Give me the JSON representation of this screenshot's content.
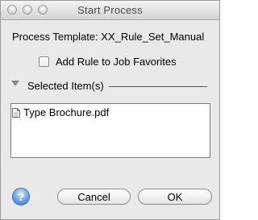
{
  "window": {
    "title": "Start  Process"
  },
  "form": {
    "template_line": "Process Template: XX_Rule_Set_Manual",
    "favorites_checkbox": {
      "label": "Add Rule to Job Favorites",
      "checked": false
    },
    "selected_section": {
      "label": "Selected Item(s)",
      "items": [
        "Type Brochure.pdf"
      ]
    }
  },
  "footer": {
    "help_glyph": "?",
    "cancel_label": "Cancel",
    "ok_label": "OK"
  }
}
